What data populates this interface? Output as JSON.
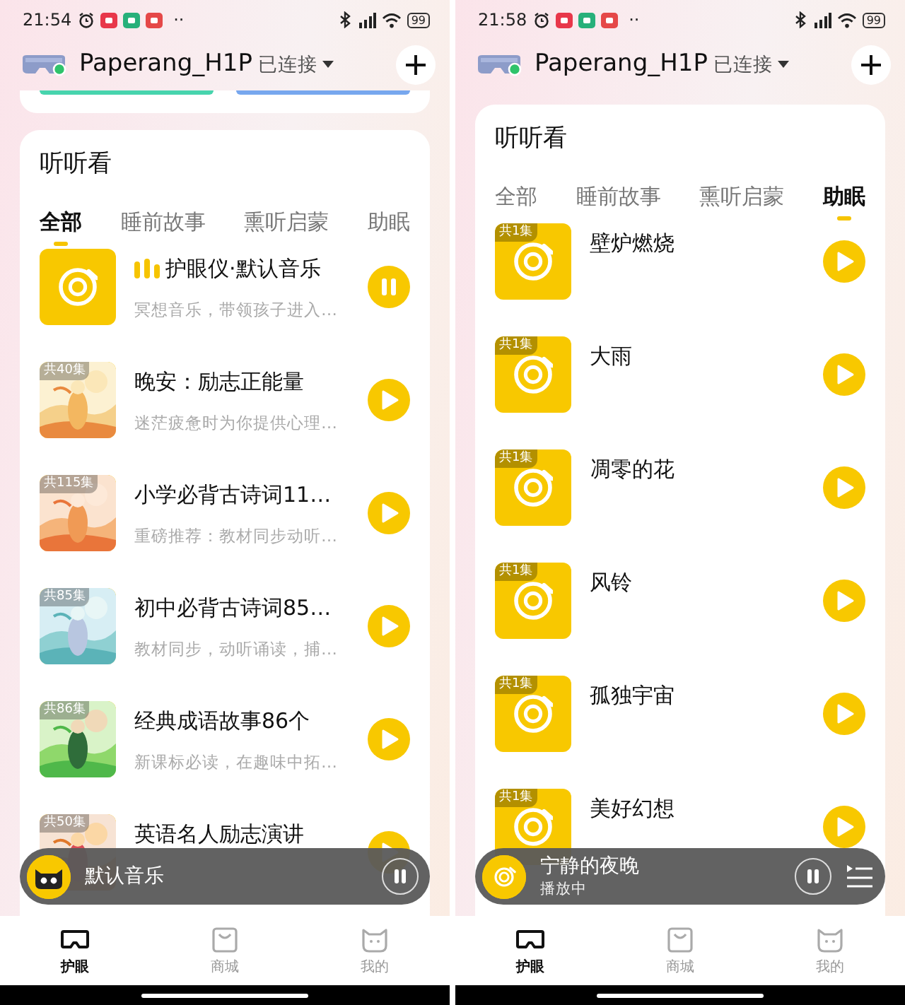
{
  "phones": [
    {
      "status_bar": {
        "time": "21:54",
        "more": "··",
        "battery": "99"
      },
      "header": {
        "device": "Paperang_H1P",
        "connection": "已连接",
        "connected": true
      },
      "peek_card": true,
      "section": {
        "title": "听听看",
        "tabs": [
          {
            "label": "全部",
            "selected": true
          },
          {
            "label": "睡前故事",
            "selected": false
          },
          {
            "label": "熏听启蒙",
            "selected": false
          },
          {
            "label": "助眠",
            "selected": false
          }
        ],
        "items": [
          {
            "kind": "disc",
            "title": "护眼仪·默认音乐",
            "subtitle": "冥想音乐，带领孩子进入…",
            "playing": true
          },
          {
            "kind": "picture",
            "badge": "共40集",
            "title": "晚安：励志正能量",
            "subtitle": "迷茫疲惫时为你提供心理…",
            "playing": false
          },
          {
            "kind": "picture",
            "badge": "共115集",
            "title": "小学必背古诗词11…",
            "subtitle": "重磅推荐：教材同步动听…",
            "playing": false
          },
          {
            "kind": "picture",
            "badge": "共85集",
            "title": "初中必背古诗词85…",
            "subtitle": "教材同步，动听诵读，捕…",
            "playing": false
          },
          {
            "kind": "picture",
            "badge": "共86集",
            "title": "经典成语故事86个",
            "subtitle": "新课标必读，在趣味中拓…",
            "playing": false
          },
          {
            "kind": "picture",
            "badge": "共50集",
            "title": "英语名人励志演讲",
            "playing": false
          }
        ]
      },
      "player": {
        "kind": "cat",
        "title": "默认音乐",
        "playing": true,
        "playlist": false
      },
      "nav": [
        {
          "label": "护眼",
          "selected": true
        },
        {
          "label": "商城",
          "selected": false
        },
        {
          "label": "我的",
          "selected": false
        }
      ]
    },
    {
      "status_bar": {
        "time": "21:58",
        "more": "··",
        "battery": "99"
      },
      "header": {
        "device": "Paperang_H1P",
        "connection": "已连接",
        "connected": true
      },
      "peek_card": false,
      "section": {
        "title": "听听看",
        "tabs": [
          {
            "label": "全部",
            "selected": false
          },
          {
            "label": "睡前故事",
            "selected": false
          },
          {
            "label": "熏听启蒙",
            "selected": false
          },
          {
            "label": "助眠",
            "selected": true
          }
        ],
        "items": [
          {
            "kind": "disc",
            "badge": "共1集",
            "title": "壁炉燃烧",
            "playing": false
          },
          {
            "kind": "disc",
            "badge": "共1集",
            "title": "大雨",
            "playing": false
          },
          {
            "kind": "disc",
            "badge": "共1集",
            "title": "凋零的花",
            "playing": false
          },
          {
            "kind": "disc",
            "badge": "共1集",
            "title": "风铃",
            "playing": false
          },
          {
            "kind": "disc",
            "badge": "共1集",
            "title": "孤独宇宙",
            "playing": false
          },
          {
            "kind": "disc",
            "badge": "共1集",
            "title": "美好幻想",
            "playing": false
          }
        ]
      },
      "player": {
        "kind": "disc",
        "title": "宁静的夜晚",
        "status": "播放中",
        "playing": true,
        "playlist": true
      },
      "nav": [
        {
          "label": "护眼",
          "selected": true
        },
        {
          "label": "商城",
          "selected": false
        },
        {
          "label": "我的",
          "selected": false
        }
      ]
    }
  ]
}
